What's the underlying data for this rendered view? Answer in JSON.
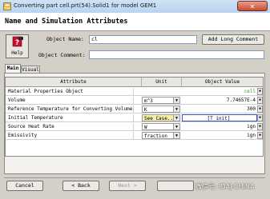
{
  "window": {
    "title": "Converting part cell.prt(54).Solid1 for model GEM1",
    "close_glyph": "✕"
  },
  "section_title": "Name and Simulation Attributes",
  "help": {
    "label": "Help",
    "icon": "question-mark-icon"
  },
  "object_name": {
    "label": "Object Name:",
    "value": "cl"
  },
  "object_comment": {
    "label": "Object Comment:",
    "value": ""
  },
  "add_long_comment_label": "Add Long Comment",
  "tabs": [
    {
      "label": "Main",
      "active": true
    },
    {
      "label": "Visual",
      "active": false
    }
  ],
  "table": {
    "headers": {
      "attribute": "Attribute",
      "unit": "Unit",
      "value": "Object Value"
    },
    "rows": [
      {
        "attribute": "Material Properties Object",
        "unit": "",
        "value": "cell",
        "value_color": "#2e9a2e",
        "has_unit_dropdown": false,
        "has_value_button": true
      },
      {
        "attribute": "Volume",
        "unit": "m^3",
        "value": "7.74657E-4",
        "has_unit_dropdown": true,
        "has_value_button": true
      },
      {
        "attribute": "Reference Temperature for Converting Volume to Mass",
        "unit": "K",
        "value": "300",
        "has_unit_dropdown": true,
        "has_value_button": true
      },
      {
        "attribute": "Initial Temperature",
        "unit": "See Case...",
        "value": "[T_init]",
        "unit_highlight": true,
        "value_selected": true,
        "has_unit_dropdown": true,
        "has_value_button": true
      },
      {
        "attribute": "Source Heat Rate",
        "unit": "W",
        "value": "ign",
        "has_unit_dropdown": true,
        "has_value_button": true
      },
      {
        "attribute": "Emissivity",
        "unit": "fraction",
        "value": "ign",
        "has_unit_dropdown": true,
        "has_value_button": true
      }
    ]
  },
  "footer": {
    "cancel": "Cancel",
    "back": "< Back",
    "next": "Next >"
  },
  "watermark": "微信号: IDAJ-CHINA",
  "colors": {
    "accent_blue": "#3a4fd0",
    "highlight_yellow": "#f6f0a8",
    "close_red": "#c74a33"
  }
}
